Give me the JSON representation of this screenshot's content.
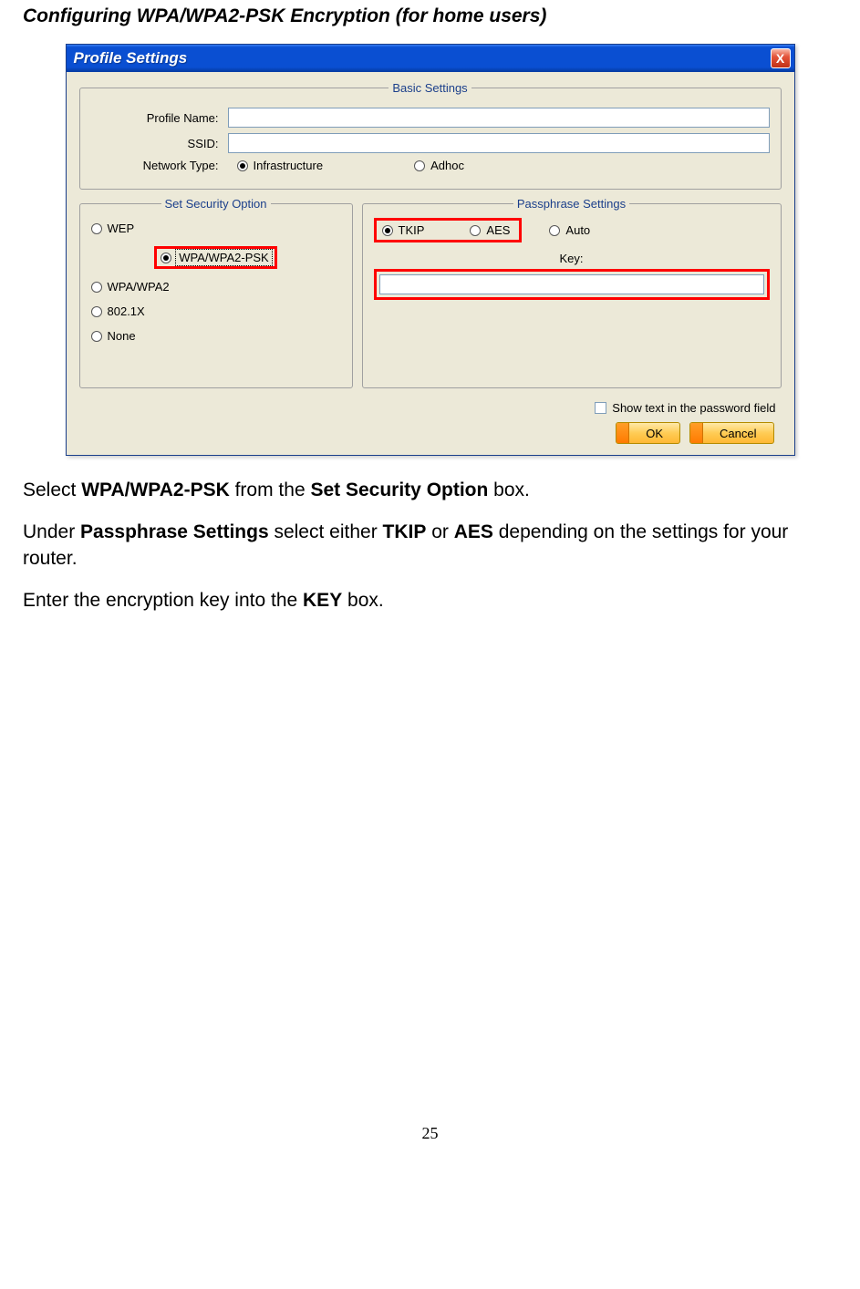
{
  "heading": "Configuring WPA/WPA2-PSK Encryption (for home users)",
  "dialog": {
    "title": "Profile Settings",
    "close": "X",
    "basic": {
      "legend": "Basic Settings",
      "profile_name_label": "Profile Name:",
      "profile_name_value": "",
      "ssid_label": "SSID:",
      "ssid_value": "",
      "network_type_label": "Network Type:",
      "infra": "Infrastructure",
      "adhoc": "Adhoc"
    },
    "security": {
      "legend": "Set Security Option",
      "wep": "WEP",
      "wpa_psk": "WPA/WPA2-PSK",
      "wpa": "WPA/WPA2",
      "x8021": "802.1X",
      "none": "None"
    },
    "passphrase": {
      "legend": "Passphrase Settings",
      "tkip": "TKIP",
      "aes": "AES",
      "auto": "Auto",
      "key_label": "Key:",
      "key_value": ""
    },
    "show_text": "Show text in the password field",
    "ok": "OK",
    "cancel": "Cancel"
  },
  "instructions": {
    "p1_a": "Select ",
    "p1_b": "WPA/WPA2-PSK",
    "p1_c": " from the ",
    "p1_d": "Set Security Option",
    "p1_e": " box.",
    "p2_a": "Under ",
    "p2_b": "Passphrase Settings",
    "p2_c": " select either ",
    "p2_d": "TKIP",
    "p2_e": " or ",
    "p2_f": "AES",
    "p2_g": " depending on the settings for your router.",
    "p3_a": "Enter the encryption key into the ",
    "p3_b": "KEY",
    "p3_c": " box."
  },
  "page_number": "25"
}
